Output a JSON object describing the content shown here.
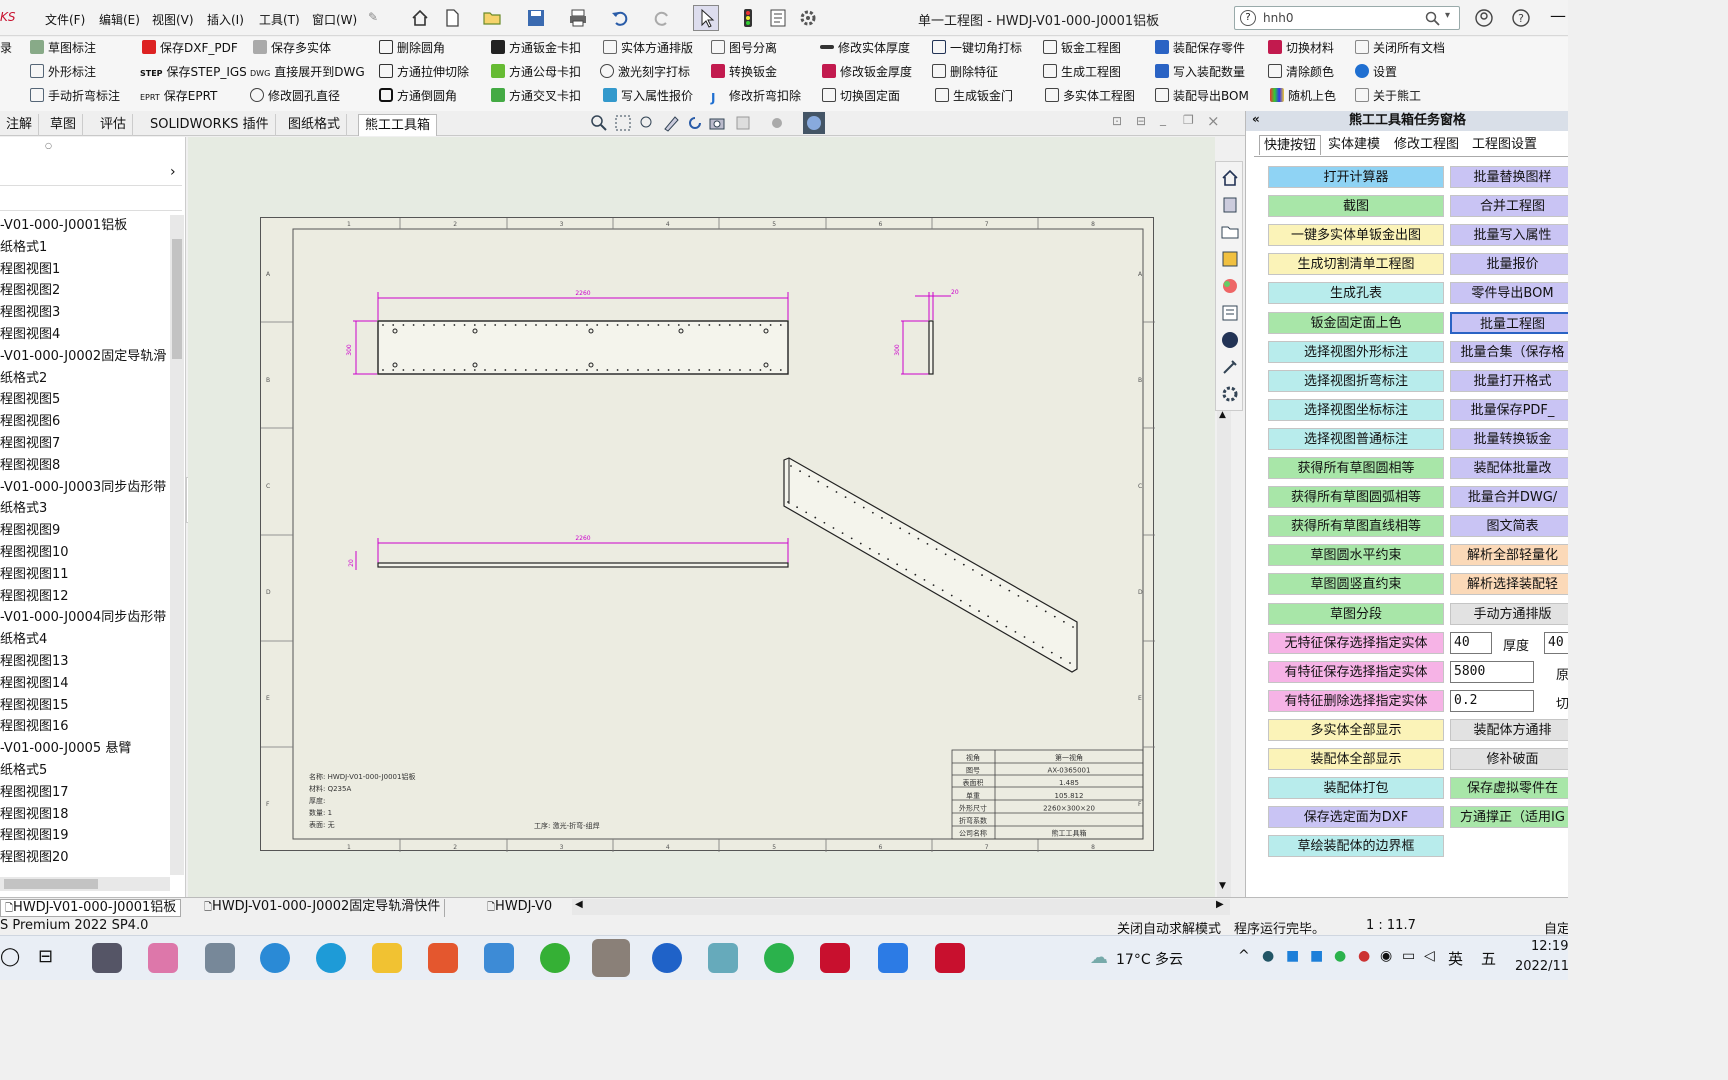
{
  "menubar": {
    "logo": "KS",
    "menus": [
      "文件(F)",
      "编辑(E)",
      "视图(V)",
      "插入(I)",
      "工具(T)",
      "窗口(W)"
    ],
    "doc_title": "单一工程图 - HWDJ-V01-000-J0001铝板",
    "search_value": "hnh0"
  },
  "ribbon": {
    "rows": [
      [
        "录",
        "草图标注",
        "保存DXF_PDF",
        "保存多实体",
        "删除圆角",
        "方通钣金卡扣",
        "实体方通排版",
        "图号分离",
        "修改实体厚度",
        "一键切角打标",
        "钣金工程图",
        "装配保存零件",
        "切换材料",
        "关闭所有文档"
      ],
      [
        "外形标注",
        "保存STEP_IGS",
        "直接展开到DWG",
        "方通拉伸切除",
        "方通公母卡扣",
        "激光刻字打标",
        "转换钣金",
        "修改钣金厚度",
        "删除特征",
        "生成工程图",
        "写入装配数量",
        "清除颜色",
        "设置"
      ],
      [
        "手动折弯标注",
        "保存EPRT",
        "修改圆孔直径",
        "方通倒圆角",
        "方通交叉卡扣",
        "写入属性报价",
        "修改折弯扣除",
        "切换固定面",
        "生成钣金门",
        "多实体工程图",
        "装配导出BOM",
        "随机上色",
        "关于熊工"
      ]
    ],
    "prefix_step": "STEP",
    "prefix_dwg": "DWG",
    "prefix_eprt": "EPRT"
  },
  "tabs": [
    "注解",
    "草图",
    "评估",
    "SOLIDWORKS 插件",
    "图纸格式",
    "熊工工具箱"
  ],
  "tree": {
    "items": [
      "-V01-000-J0001铝板",
      "纸格式1",
      "程图视图1",
      "程图视图2",
      "程图视图3",
      "程图视图4",
      "-V01-000-J0002固定导轨滑",
      "纸格式2",
      "程图视图5",
      "程图视图6",
      "程图视图7",
      "程图视图8",
      "-V01-000-J0003同步齿形带",
      "纸格式3",
      "程图视图9",
      "程图视图10",
      "程图视图11",
      "程图视图12",
      "-V01-000-J0004同步齿形带",
      "纸格式4",
      "程图视图13",
      "程图视图14",
      "程图视图15",
      "程图视图16",
      "-V01-000-J0005 悬臂",
      "纸格式5",
      "程图视图17",
      "程图视图18",
      "程图视图19",
      "程图视图20"
    ]
  },
  "drawing": {
    "dim_top_length": "2260",
    "dim_side": "300",
    "dim_thickness": "20",
    "dim_side_view": "300",
    "dim_bottom_length": "2260",
    "dim_bottom_height": "20",
    "notes": [
      "名称: HWDJ-V01-000-J0001铝板",
      "材料: Q235A",
      "厚度:",
      "数量: 1",
      "表面: 无"
    ],
    "process": "工序: 激光-折弯-组焊",
    "title_block": [
      [
        "视角",
        "第一视角"
      ],
      [
        "图号",
        "AX-0365001"
      ],
      [
        "表面积",
        "1.485"
      ],
      [
        "单重",
        "105.812"
      ],
      [
        "外形尺寸",
        "2260×300×20"
      ],
      [
        "折弯系数",
        ""
      ],
      [
        "公司名称",
        "熊工工具箱"
      ]
    ],
    "col_numbers": [
      "1",
      "2",
      "3",
      "4",
      "5",
      "6",
      "7",
      "8"
    ],
    "row_letters": [
      "A",
      "B",
      "C",
      "D",
      "E",
      "F"
    ]
  },
  "pane": {
    "title": "熊工工具箱任务窗格",
    "tabs": [
      "快捷按钮",
      "实体建模",
      "修改工程图",
      "工程图设置"
    ],
    "left_buttons": [
      {
        "label": "打开计算器",
        "color": "#8fd3f4"
      },
      {
        "label": "截图",
        "color": "#a8e6a8"
      },
      {
        "label": "一键多实体单钣金出图",
        "color": "#fbf3b8"
      },
      {
        "label": "生成切割清单工程图",
        "color": "#fbf3b8"
      },
      {
        "label": "生成孔表",
        "color": "#b8ecec"
      },
      {
        "label": "钣金固定面上色",
        "color": "#a8e6a8"
      },
      {
        "label": "选择视图外形标注",
        "color": "#b8ecec"
      },
      {
        "label": "选择视图折弯标注",
        "color": "#b8ecec"
      },
      {
        "label": "选择视图坐标标注",
        "color": "#b8ecec"
      },
      {
        "label": "选择视图普通标注",
        "color": "#b8ecec"
      },
      {
        "label": "获得所有草图圆相等",
        "color": "#a8e6a8"
      },
      {
        "label": "获得所有草图圆弧相等",
        "color": "#a8e6a8"
      },
      {
        "label": "获得所有草图直线相等",
        "color": "#a8e6a8"
      },
      {
        "label": "草图圆水平约束",
        "color": "#a8e6a8"
      },
      {
        "label": "草图圆竖直约束",
        "color": "#a8e6a8"
      },
      {
        "label": "草图分段",
        "color": "#a8e6a8"
      },
      {
        "label": "无特征保存选择指定实体",
        "color": "#f6b3e6"
      },
      {
        "label": "有特征保存选择指定实体",
        "color": "#f6b3e6"
      },
      {
        "label": "有特征删除选择指定实体",
        "color": "#f6b3e6"
      },
      {
        "label": "多实体全部显示",
        "color": "#fbf3b8"
      },
      {
        "label": "装配体全部显示",
        "color": "#fbf3b8"
      },
      {
        "label": "装配体打包",
        "color": "#b8ecec"
      },
      {
        "label": "保存选定面为DXF",
        "color": "#c9c4f4"
      },
      {
        "label": "草绘装配体的边界框",
        "color": "#b8ecec"
      }
    ],
    "right_buttons": [
      {
        "label": "批量替换图样",
        "color": "#c9c4f4"
      },
      {
        "label": "合并工程图",
        "color": "#c9c4f4"
      },
      {
        "label": "批量写入属性",
        "color": "#c9c4f4"
      },
      {
        "label": "批量报价",
        "color": "#c9c4f4"
      },
      {
        "label": "零件导出BOM",
        "color": "#c9c4f4"
      },
      {
        "label": "批量工程图",
        "color": "#c9c4f4"
      },
      {
        "label": "批量合集（保存格",
        "color": "#c9c4f4"
      },
      {
        "label": "批量打开格式",
        "color": "#c9c4f4"
      },
      {
        "label": "批量保存PDF_",
        "color": "#c9c4f4"
      },
      {
        "label": "批量转换钣金",
        "color": "#c9c4f4"
      },
      {
        "label": "装配体批量改",
        "color": "#c9c4f4"
      },
      {
        "label": "批量合并DWG/",
        "color": "#c9c4f4"
      },
      {
        "label": "图文简表",
        "color": "#c9c4f4"
      },
      {
        "label": "解析全部轻量化",
        "color": "#fbd9b8"
      },
      {
        "label": "解析选择装配轻",
        "color": "#fbd9b8"
      },
      {
        "label": "手动方通排版",
        "color": "#e2e2e2"
      }
    ],
    "inputs": {
      "thickness_a": "40",
      "thickness_label": "厚度",
      "thickness_b": "40",
      "length": "5800",
      "length_label": "原",
      "gap": "0.2",
      "gap_label": "切"
    },
    "right_buttons_lower": [
      {
        "label": "装配体方通排",
        "color": "#e2e2e2"
      },
      {
        "label": "修补破面",
        "color": "#e2e2e2"
      },
      {
        "label": "保存虚拟零件在",
        "color": "#a8e6a8"
      },
      {
        "label": "方通撑正（适用IG",
        "color": "#a8e6a8"
      }
    ]
  },
  "bottom_tabs": [
    "HWDJ-V01-000-J0001铝板",
    "HWDJ-V01-000-J0002固定导轨滑快件",
    "HWDJ-V0"
  ],
  "status": {
    "left": "S Premium 2022 SP4.0",
    "mode": "关闭自动求解模式",
    "message": "程序运行完毕。",
    "scale": "1 : 11.7",
    "right": "自定"
  },
  "taskbar": {
    "weather": "17°C 多云",
    "ime": "英",
    "time": "12:19",
    "date": "2022/11"
  }
}
